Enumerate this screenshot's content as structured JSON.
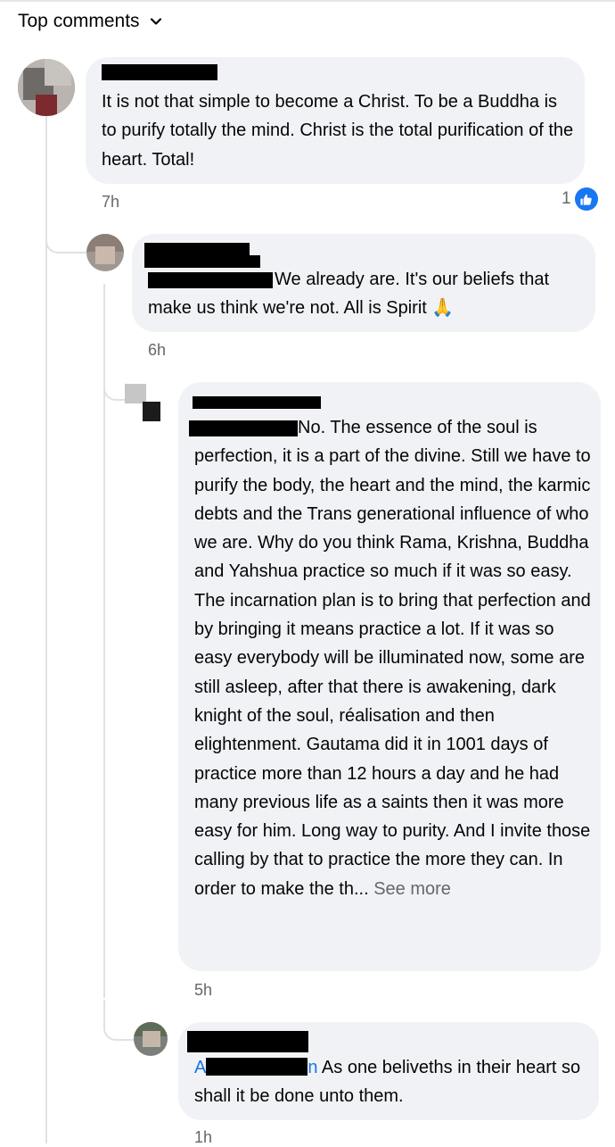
{
  "sort_label": "Top comments",
  "comments": [
    {
      "text": "It is not that simple to become a Christ. To be a Buddha is to purify totally the mind. Christ is the total purification of the heart. Total!",
      "time": "7h",
      "reactions": "1"
    },
    {
      "text": "We already are. It's our beliefs that make us think we're not. All is Spirit",
      "emoji": "🙏",
      "time": "6h"
    },
    {
      "text": "No. The essence of the soul is perfection, it is a part of the divine. Still we have to purify the body, the heart and the mind, the karmic debts and the Trans generational influence of who we are. Why do you think Rama, Krishna, Buddha and Yahshua practice so much if it was so easy. The incarnation plan is to bring that perfection and by bringing it means practice a lot. If it was so easy everybody will be illuminated now, some are still asleep, after that there is awakening, dark knight of the soul, réalisation and then elightenment. Gautama did it in 1001 days of practice more than 12 hours a day and he had many previous life as a saints then it was more easy for him. Long way to purity. And I invite those calling by that to practice the more they can. In order to make the th...",
      "see_more": "See more",
      "time": "5h"
    },
    {
      "mention_first": "A",
      "mention_last": "n",
      "text": "As one beliveths in their heart so shall it be done unto them.",
      "time": "1h"
    }
  ],
  "colors": {
    "bubble": "#f0f2f5",
    "thread_line": "#dfe1e6",
    "meta_text": "#65676b",
    "like_blue": "#1877f2",
    "mention_blue": "#1b74e4"
  },
  "icons": [
    "chevron-down-icon",
    "like-icon"
  ]
}
